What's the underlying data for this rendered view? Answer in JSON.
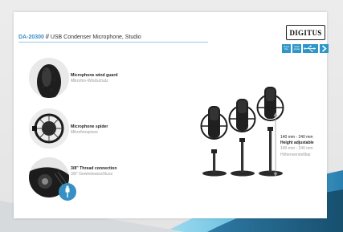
{
  "brand": {
    "logo_text": "DIGITUS"
  },
  "header": {
    "product_code": "DA-20300",
    "separator": "//",
    "product_name": "USB Condenser Microphone, Studio"
  },
  "badges": [
    {
      "label": "Plug & Play"
    },
    {
      "label": "Studio Quality"
    },
    {
      "label": "USB"
    },
    {
      "label": "next"
    }
  ],
  "features": [
    {
      "en": "Microphone wind guard",
      "de": "Mikrofon-Windschutz",
      "icon": "wind-guard-photo"
    },
    {
      "en": "Microphone spider",
      "de": "Mikrofonspinne",
      "icon": "spider-mount-photo"
    },
    {
      "en": "3/8\" Thread connection",
      "de": "3/8\" Gewindeanschluss",
      "icon": "thread-photo"
    }
  ],
  "height": {
    "range_en": "140 mm - 240 mm",
    "label_en": "Height adjustable",
    "range_de": "140 mm - 240 mm",
    "label_de": "Höhenverstellbar"
  },
  "colors": {
    "accent": "#3690c4",
    "dark_band": "#1f5f82",
    "light_band": "#8fd0e6"
  }
}
